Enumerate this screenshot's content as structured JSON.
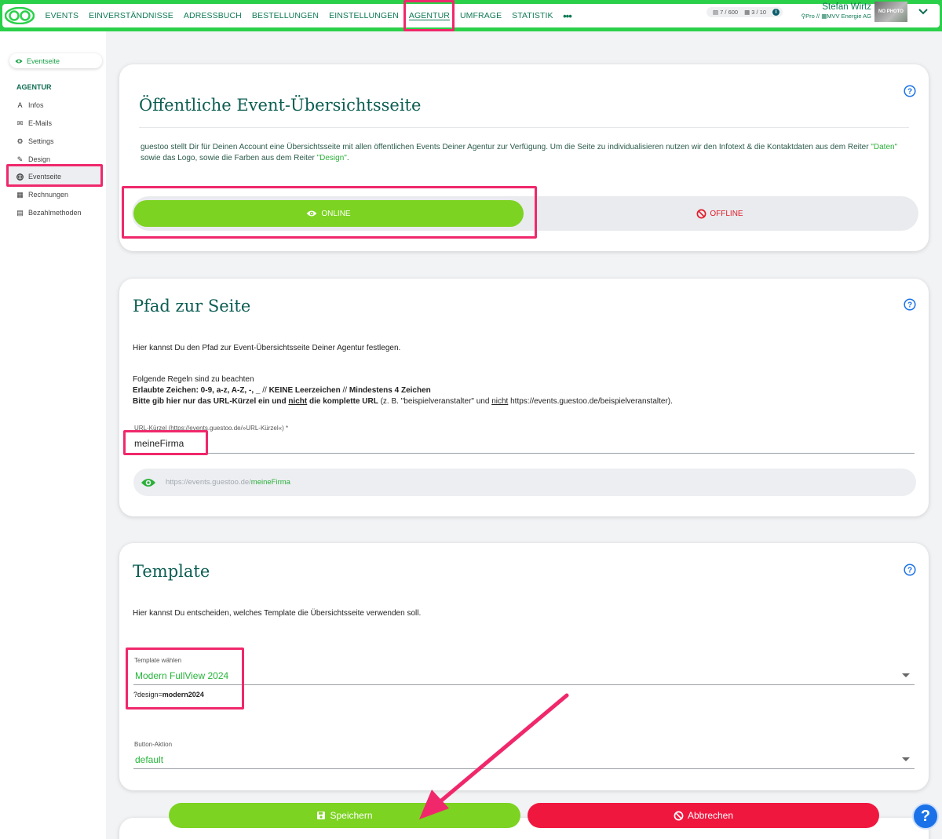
{
  "nav": {
    "items": [
      "EVENTS",
      "EINVERSTÄNDNISSE",
      "ADRESSBUCH",
      "BESTELLUNGEN",
      "EINSTELLUNGEN",
      "AGENTUR",
      "UMFRAGE",
      "STATISTIK"
    ],
    "active": "AGENTUR",
    "more": "•••"
  },
  "quota": {
    "events": "7 / 600",
    "other": "3 / 10",
    "info": "i"
  },
  "user": {
    "name": "Stefan Wirtz",
    "plan": "Pro",
    "separator": "//",
    "company": "MVV Energie AG",
    "avatar_text": "NO PHOTO"
  },
  "sidebar": {
    "top_pill": "Eventseite",
    "heading": "AGENTUR",
    "items": [
      {
        "label": "Infos",
        "icon": "font-icon"
      },
      {
        "label": "E-Mails",
        "icon": "envelope-icon"
      },
      {
        "label": "Settings",
        "icon": "gear-icon"
      },
      {
        "label": "Design",
        "icon": "brush-icon"
      },
      {
        "label": "Eventseite",
        "icon": "globe-icon"
      },
      {
        "label": "Rechnungen",
        "icon": "file-icon"
      },
      {
        "label": "Bezahlmethoden",
        "icon": "cash-register-icon"
      }
    ]
  },
  "card1": {
    "title": "Öffentliche Event-Übersichtsseite",
    "text_before": "guestoo stellt Dir für Deinen Account eine Übersichtsseite mit allen öffentlichen Events Deiner Agentur zur Verfügung. Um die Seite zu individualisieren nutzen wir den Infotext & die Kontaktdaten aus dem Reiter ",
    "link1": "\"Daten\"",
    "text_middle": " sowie das Logo, sowie die Farben aus dem Reiter ",
    "link2": "\"Design\"",
    "text_after": ".",
    "online_label": "ONLINE",
    "offline_label": "OFFLINE"
  },
  "card2": {
    "title": "Pfad zur Seite",
    "intro": "Hier kannst Du den Pfad zur Event-Übersichtsseite Deiner Agentur festlegen.",
    "rules_heading": "Folgende Regeln sind zu beachten",
    "rule1_bold": "Erlaubte Zeichen: 0-9, a-z, A-Z, -, _",
    "rule1_sep": " // ",
    "rule1_bold2": "KEINE Leerzeichen",
    "rule1_sep2": " // ",
    "rule1_bold3": "Mindestens 4 Zeichen",
    "rule2_bold_a": "Bitte gib hier nur das URL-Kürzel ein und ",
    "rule2_underline": "nicht",
    "rule2_bold_b": " die komplette URL",
    "rule2_rest_a": " (z. B. \"beispielveranstalter\" und ",
    "rule2_underline2": "nicht",
    "rule2_rest_b": " https://events.guestoo.de/beispielveranstalter).",
    "field_label": "URL-Kürzel (https://events.guestoo.de/»URL-Kürzel«) *",
    "field_value": "meineFirma",
    "preview_base": "https://events.guestoo.de/",
    "preview_slug": "meineFirma"
  },
  "card3": {
    "title": "Template",
    "intro": "Hier kannst Du entscheiden, welches Template die Übersichtsseite verwenden soll.",
    "template_label": "Template wählen",
    "template_value": "Modern FullView 2024",
    "design_hint_prefix": "?design=",
    "design_hint_value": "modern2024",
    "button_label": "Button-Aktion",
    "button_value": "default"
  },
  "actions": {
    "save": "Speichern",
    "cancel": "Abbrechen",
    "help": "?"
  },
  "colors": {
    "brand_green": "#2bd04a",
    "button_green": "#7cd321",
    "danger_red": "#f0173f",
    "highlight_pink": "#f0286b",
    "title_teal": "#0b5d52"
  }
}
